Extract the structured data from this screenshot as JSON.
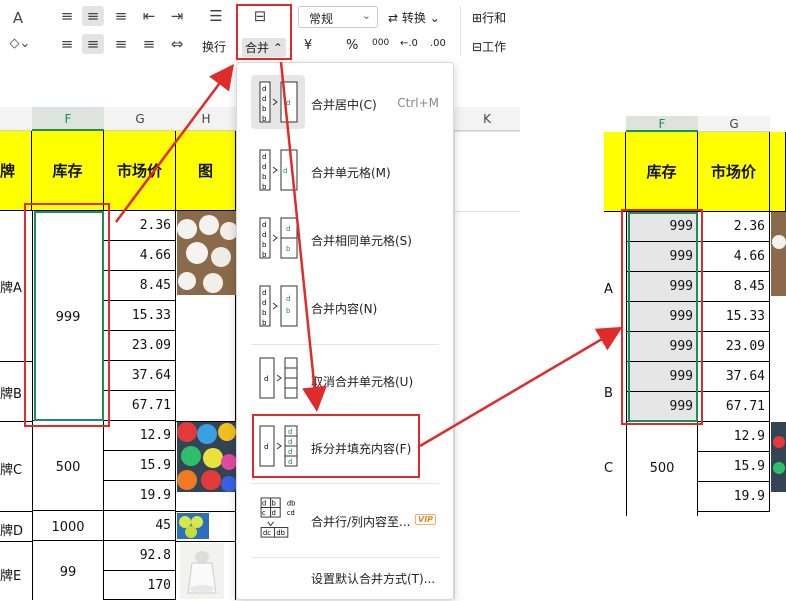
{
  "ribbon": {
    "wrap_label": "换行",
    "merge_label": "合并",
    "format_value": "常规",
    "convert_label": "转换",
    "rowcol_label": "行和",
    "sheet_label": "工作",
    "currency_symbol": "¥",
    "percent_symbol": "%",
    "thousands_symbol": "000",
    "dec_inc": "←.0",
    "dec_dec": ".00"
  },
  "sheet": {
    "col_f": "F",
    "col_g": "G",
    "col_h": "H",
    "col_k": "K",
    "header_stock": "库存",
    "header_price": "市场价",
    "header_brand_partial": "牌",
    "header_pic_partial": "图",
    "brands": [
      "牌A",
      "牌B",
      "牌C",
      "牌D",
      "牌E"
    ],
    "stocks": [
      "999",
      "500",
      "1000",
      "99"
    ],
    "prices": [
      "2.36",
      "4.66",
      "8.45",
      "15.33",
      "23.09",
      "37.64",
      "67.71",
      "12.9",
      "15.9",
      "19.9",
      "45",
      "92.8",
      "170"
    ]
  },
  "menu": {
    "items": [
      {
        "label": "合并居中(C)",
        "shortcut": "Ctrl+M"
      },
      {
        "label": "合并单元格(M)"
      },
      {
        "label": "合并相同单元格(S)"
      },
      {
        "label": "合并内容(N)"
      },
      {
        "label": "取消合并单元格(U)"
      },
      {
        "label": "拆分并填充内容(F)"
      },
      {
        "label": "合并行/列内容至..."
      },
      {
        "label": "设置默认合并方式(T)..."
      }
    ],
    "vip_badge": "VIP"
  },
  "result": {
    "col_f": "F",
    "col_g": "G",
    "header_stock": "库存",
    "header_price": "市场价",
    "stocks": [
      "999",
      "999",
      "999",
      "999",
      "999",
      "999",
      "999",
      "500"
    ],
    "prices": [
      "2.36",
      "4.66",
      "8.45",
      "15.33",
      "23.09",
      "37.64",
      "67.71",
      "12.9",
      "15.9",
      "19.9"
    ],
    "brand_letters": [
      "A",
      "B",
      "C"
    ]
  },
  "colors": {
    "highlight": "#ffff00",
    "accent_red": "#e02b2b",
    "select_green": "#1a8f5a"
  }
}
